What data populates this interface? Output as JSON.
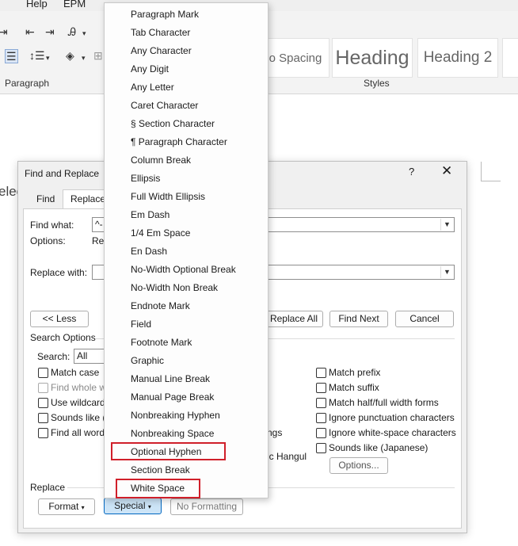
{
  "menubar": {
    "items": [
      "Help",
      "EPM"
    ]
  },
  "ribbon": {
    "groups": {
      "paragraph": "Paragraph",
      "styles": "Styles"
    },
    "styles_gallery": [
      "o Spacing",
      "Heading",
      "Heading 2"
    ]
  },
  "document": {
    "partial_text": "elec"
  },
  "dialog": {
    "title": "Find and Replace",
    "help": "?",
    "close": "✕",
    "tabs": [
      "Find",
      "Replace"
    ],
    "find_what_label": "Find what:",
    "find_what_value": "^-",
    "options_label": "Options:",
    "options_value": "Rev",
    "replace_with_label": "Replace with:",
    "replace_with_value": "",
    "less_button": "<< Less",
    "replace_all_button": "Replace All",
    "find_next_button": "Find Next",
    "cancel_button": "Cancel",
    "search_options_label": "Search Options",
    "search_label": "Search:",
    "search_value": "All",
    "left_options": [
      {
        "label": "Match case",
        "checked": false,
        "disabled": false
      },
      {
        "label": "Find whole w",
        "checked": false,
        "disabled": true
      },
      {
        "label": "Use wildcard",
        "checked": false,
        "disabled": false
      },
      {
        "label": "Sounds like (",
        "checked": false,
        "disabled": false
      },
      {
        "label": "Find all word",
        "checked": false,
        "disabled": false
      }
    ],
    "middle_fragments": [
      "ngs",
      "ic Hangul"
    ],
    "right_options": [
      {
        "label": "Match prefix",
        "checked": false
      },
      {
        "label": "Match suffix",
        "checked": false
      },
      {
        "label": "Match half/full width forms",
        "checked": false
      },
      {
        "label": "Ignore punctuation characters",
        "checked": false
      },
      {
        "label": "Ignore white-space characters",
        "checked": false
      },
      {
        "label": "Sounds like (Japanese)",
        "checked": false
      }
    ],
    "options_button": "Options...",
    "replace_section_label": "Replace",
    "format_button": "Format",
    "special_button": "Special",
    "no_formatting_button": "No Formatting"
  },
  "special_menu": {
    "items": [
      "Paragraph Mark",
      "Tab Character",
      "Any Character",
      "Any Digit",
      "Any Letter",
      "Caret Character",
      "§ Section Character",
      "¶ Paragraph Character",
      "Column Break",
      "Ellipsis",
      "Full Width Ellipsis",
      "Em Dash",
      "1/4 Em Space",
      "En Dash",
      "No-Width Optional Break",
      "No-Width Non Break",
      "Endnote Mark",
      "Field",
      "Footnote Mark",
      "Graphic",
      "Manual Line Break",
      "Manual Page Break",
      "Nonbreaking Hyphen",
      "Nonbreaking Space",
      "Optional Hyphen",
      "Section Break",
      "White Space"
    ],
    "highlighted": [
      "Optional Hyphen",
      "White Space"
    ],
    "highlight_color": "#d01f2a"
  }
}
